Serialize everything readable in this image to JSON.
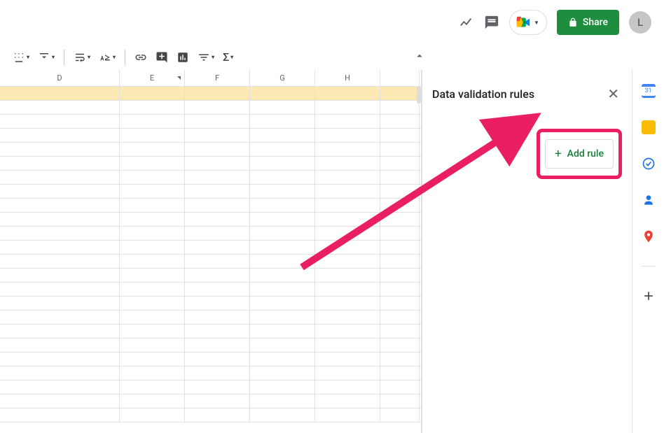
{
  "header": {
    "share_label": "Share",
    "avatar_initial": "L"
  },
  "columns": [
    "D",
    "E",
    "F",
    "G",
    "H"
  ],
  "sidebar": {
    "title": "Data validation rules",
    "add_rule_label": "Add rule"
  }
}
